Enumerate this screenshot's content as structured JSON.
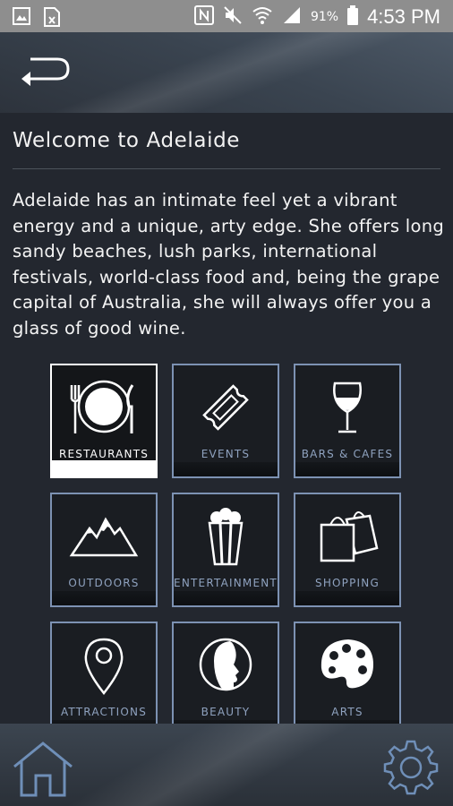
{
  "status_bar": {
    "battery": "91%",
    "time": "4:53 PM",
    "icons": [
      "image-icon",
      "file-excel-icon",
      "nfc-icon",
      "mute-icon",
      "wifi-icon",
      "signal-icon",
      "battery-icon"
    ]
  },
  "header": {
    "back_icon": "back-arrow-icon"
  },
  "main": {
    "title": "Welcome to Adelaide",
    "intro": "Adelaide has an intimate feel yet a vibrant energy and a unique, arty edge. She offers long sandy beaches, lush parks, international festivals, world-class food and, being the grape capital of Australia, she will always offer you a glass of good wine."
  },
  "categories": [
    {
      "label": "RESTAURANTS",
      "icon": "plate-cutlery-icon",
      "selected": true
    },
    {
      "label": "EVENTS",
      "icon": "ticket-icon",
      "selected": false
    },
    {
      "label": "BARS & CAFES",
      "icon": "wine-glass-icon",
      "selected": false
    },
    {
      "label": "OUTDOORS",
      "icon": "mountains-icon",
      "selected": false
    },
    {
      "label": "ENTERTAINMENT",
      "icon": "popcorn-icon",
      "selected": false
    },
    {
      "label": "SHOPPING",
      "icon": "shopping-bags-icon",
      "selected": false
    },
    {
      "label": "ATTRACTIONS",
      "icon": "map-pin-icon",
      "selected": false
    },
    {
      "label": "BEAUTY",
      "icon": "face-profile-icon",
      "selected": false
    },
    {
      "label": "ARTS",
      "icon": "palette-icon",
      "selected": false
    }
  ],
  "bottom_bar": {
    "home_icon": "home-icon",
    "settings_icon": "gear-icon"
  },
  "colors": {
    "tile_border": "#7d92b3",
    "tile_label": "#8fa2bf",
    "selected": "#ffffff",
    "background": "#23272f"
  }
}
